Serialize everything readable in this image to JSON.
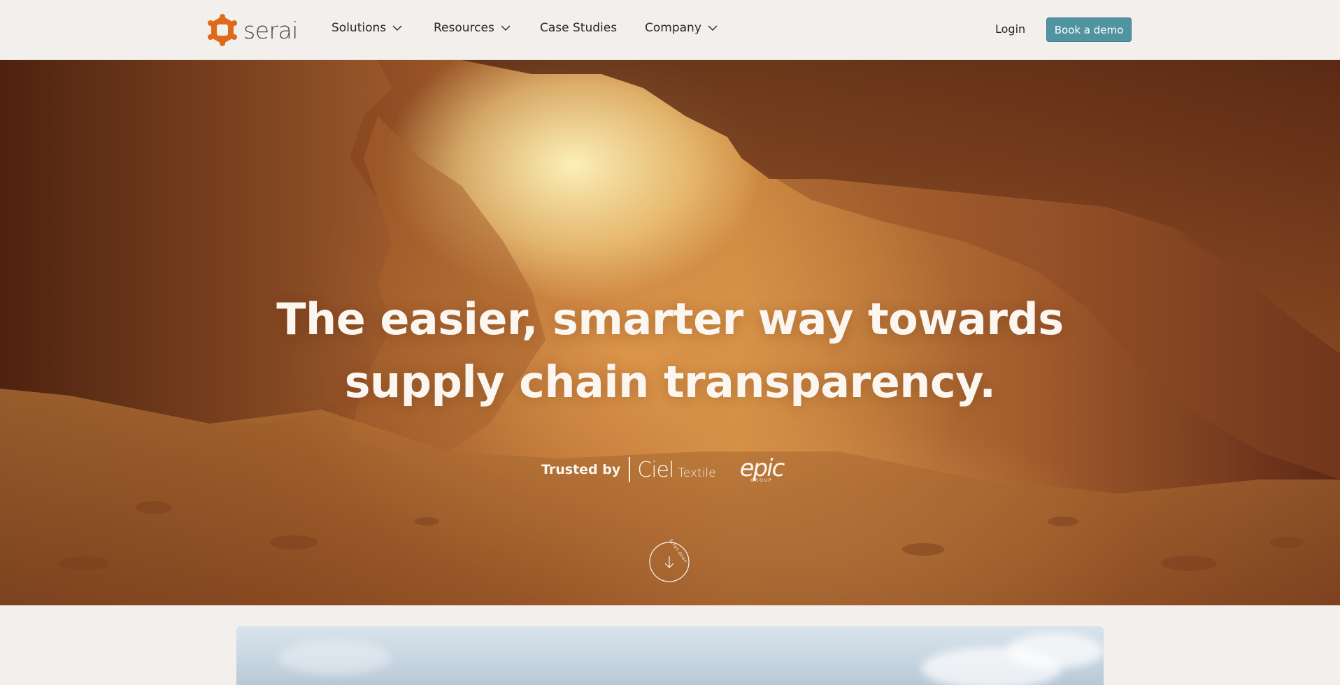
{
  "brand": {
    "name": "serai",
    "logo_color": "#e06a1b"
  },
  "nav": {
    "items": [
      {
        "label": "Solutions",
        "has_dropdown": true
      },
      {
        "label": "Resources",
        "has_dropdown": true
      },
      {
        "label": "Case Studies",
        "has_dropdown": false
      },
      {
        "label": "Company",
        "has_dropdown": true
      }
    ],
    "login_label": "Login",
    "demo_label": "Book a demo",
    "demo_color": "#4f949f"
  },
  "hero": {
    "title_line1": "The easier, smarter way towards",
    "title_line2": "supply chain transparency.",
    "trusted_label": "Trusted by",
    "partners": [
      {
        "name": "Ciel",
        "sub": "Textile"
      },
      {
        "name": "epic",
        "sub": "GROUP"
      }
    ],
    "scroll_label": "Scroll down",
    "scroll_icon": "arrow-down-icon"
  }
}
